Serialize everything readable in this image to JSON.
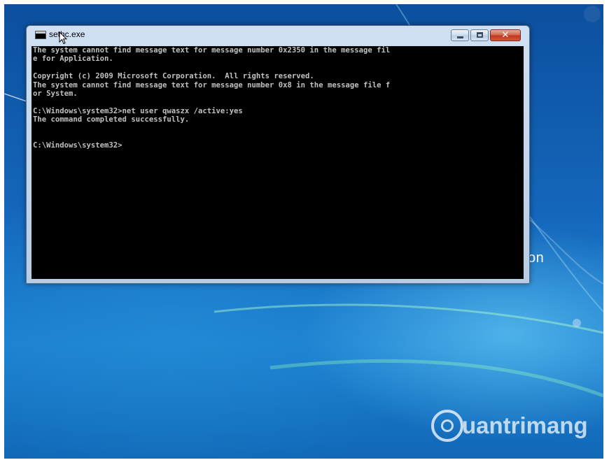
{
  "window": {
    "title": "sethc.exe",
    "icon": "console-icon",
    "buttons": {
      "minimize": "minimize-icon",
      "maximize": "maximize-icon",
      "close": "close-icon"
    },
    "close_glyph": "✕"
  },
  "console": {
    "lines": [
      "The system cannot find message text for message number 0x2350 in the message fil",
      "e for Application.",
      "",
      "Copyright (c) 2009 Microsoft Corporation.  All rights reserved.",
      "The system cannot find message text for message number 0x8 in the message file f",
      "or System.",
      "",
      "C:\\Windows\\system32>net user qwaszx /active:yes",
      "The command completed successfully.",
      "",
      "",
      "C:\\Windows\\system32>"
    ]
  },
  "desktop": {
    "partial_text": "on"
  },
  "watermark": {
    "text": "uantrimang"
  },
  "colors": {
    "console_bg": "#000000",
    "console_fg": "#c0c0c0",
    "desktop_blue": "#1466bb"
  }
}
